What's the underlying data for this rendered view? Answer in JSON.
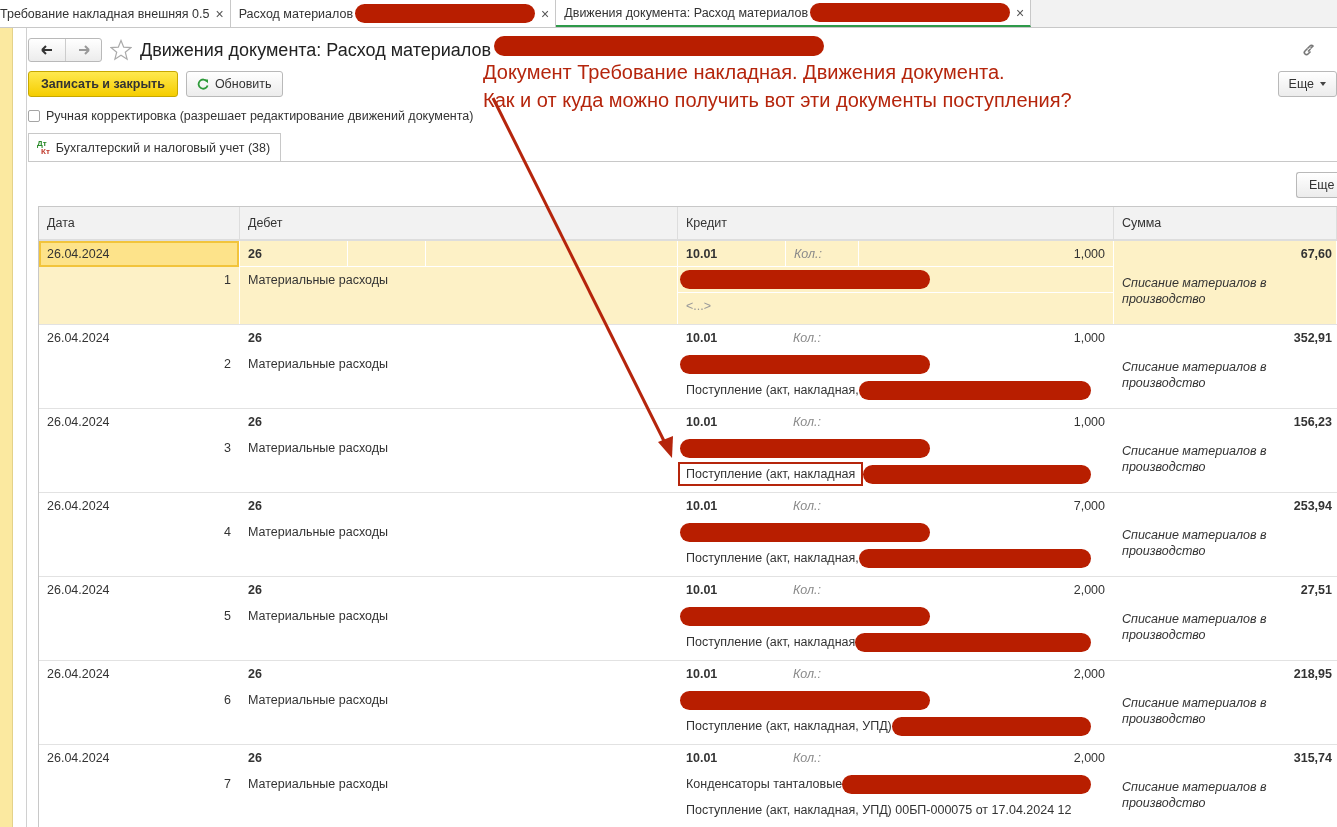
{
  "open_tabs": [
    {
      "label": "Требование накладная внешняя 0.5",
      "redacted": false,
      "selected": false,
      "close": "×"
    },
    {
      "label": "Расход материалов",
      "redacted": true,
      "selected": false,
      "close": "×"
    },
    {
      "label": "Движения документа: Расход материалов",
      "redacted": true,
      "selected": true,
      "close": "×"
    }
  ],
  "form": {
    "title": {
      "text": "Движения документа: Расход материалов",
      "redacted": true
    },
    "buttons": [
      {
        "label": "Записать и закрыть",
        "kind": "primary"
      },
      {
        "label": "Обновить",
        "kind": "refresh"
      },
      {
        "label": "Еще",
        "kind": "menu"
      }
    ],
    "manual_edit": {
      "label": "Ручная корректировка (разрешает редактирование движений документа)",
      "checked": false
    },
    "sections": [
      {
        "label": "Бухгалтерский и налоговый учет (38)",
        "selected": true,
        "icon_marks": [
          "Дт",
          "Кт"
        ]
      }
    ]
  },
  "table": {
    "more_button": "Еще",
    "columns": [
      "Дата",
      "Дебет",
      "Кредит",
      "Сумма"
    ],
    "rows": [
      {
        "date": "26.04.2024",
        "number": "1",
        "debit_account": "26",
        "debit_name": "Материальные расходы",
        "credit_account": "10.01",
        "qty_label": "Кол.:",
        "qty": "1,000",
        "amount": "67,60",
        "content": "Списание материалов в производство",
        "selected": true,
        "credit_lines": [
          {
            "redacted": true
          },
          {
            "text": "<...>",
            "kind": "empty",
            "redacted": false
          }
        ]
      },
      {
        "date": "26.04.2024",
        "number": "2",
        "debit_account": "26",
        "debit_name": "Материальные расходы",
        "credit_account": "10.01",
        "qty_label": "Кол.:",
        "qty": "1,000",
        "amount": "352,91",
        "content": "Списание материалов в производство",
        "selected": false,
        "credit_lines": [
          {
            "redacted": true
          },
          {
            "text": "Поступление (акт, накладная,",
            "kind": "text",
            "redacted": true
          }
        ]
      },
      {
        "date": "26.04.2024",
        "number": "3",
        "debit_account": "26",
        "debit_name": "Материальные расходы",
        "credit_account": "10.01",
        "qty_label": "Кол.:",
        "qty": "1,000",
        "amount": "156,23",
        "content": "Списание материалов в производство",
        "selected": false,
        "credit_lines": [
          {
            "redacted": true
          },
          {
            "text": "Поступление (акт, накладная",
            "kind": "text",
            "redacted": true,
            "highlighted": true
          }
        ]
      },
      {
        "date": "26.04.2024",
        "number": "4",
        "debit_account": "26",
        "debit_name": "Материальные расходы",
        "credit_account": "10.01",
        "qty_label": "Кол.:",
        "qty": "7,000",
        "amount": "253,94",
        "content": "Списание материалов в производство",
        "selected": false,
        "credit_lines": [
          {
            "redacted": true
          },
          {
            "text": "Поступление (акт, накладная,",
            "kind": "text",
            "redacted": true
          }
        ]
      },
      {
        "date": "26.04.2024",
        "number": "5",
        "debit_account": "26",
        "debit_name": "Материальные расходы",
        "credit_account": "10.01",
        "qty_label": "Кол.:",
        "qty": "2,000",
        "amount": "27,51",
        "content": "Списание материалов в производство",
        "selected": false,
        "credit_lines": [
          {
            "redacted": true
          },
          {
            "text": "Поступление (акт, накладная",
            "kind": "text",
            "redacted": true
          }
        ]
      },
      {
        "date": "26.04.2024",
        "number": "6",
        "debit_account": "26",
        "debit_name": "Материальные расходы",
        "credit_account": "10.01",
        "qty_label": "Кол.:",
        "qty": "2,000",
        "amount": "218,95",
        "content": "Списание материалов в производство",
        "selected": false,
        "credit_lines": [
          {
            "redacted": true
          },
          {
            "text": "Поступление (акт, накладная, УПД)",
            "kind": "text",
            "redacted": true
          }
        ]
      },
      {
        "date": "26.04.2024",
        "number": "7",
        "debit_account": "26",
        "debit_name": "Материальные расходы",
        "credit_account": "10.01",
        "qty_label": "Кол.:",
        "qty": "2,000",
        "amount": "315,74",
        "content": "Списание материалов в производство",
        "selected": false,
        "credit_lines": [
          {
            "text": "Конденсаторы танталовые",
            "kind": "text",
            "redacted": true
          },
          {
            "text": "Поступление (акт, накладная, УПД) 00БП-000075 от 17.04.2024 12",
            "kind": "text",
            "redacted": false
          }
        ]
      }
    ]
  },
  "annotation": {
    "lines": [
      "Документ Требование накладная. Движения документа.",
      "Как и от куда можно получить вот эти документы поступления?"
    ]
  }
}
